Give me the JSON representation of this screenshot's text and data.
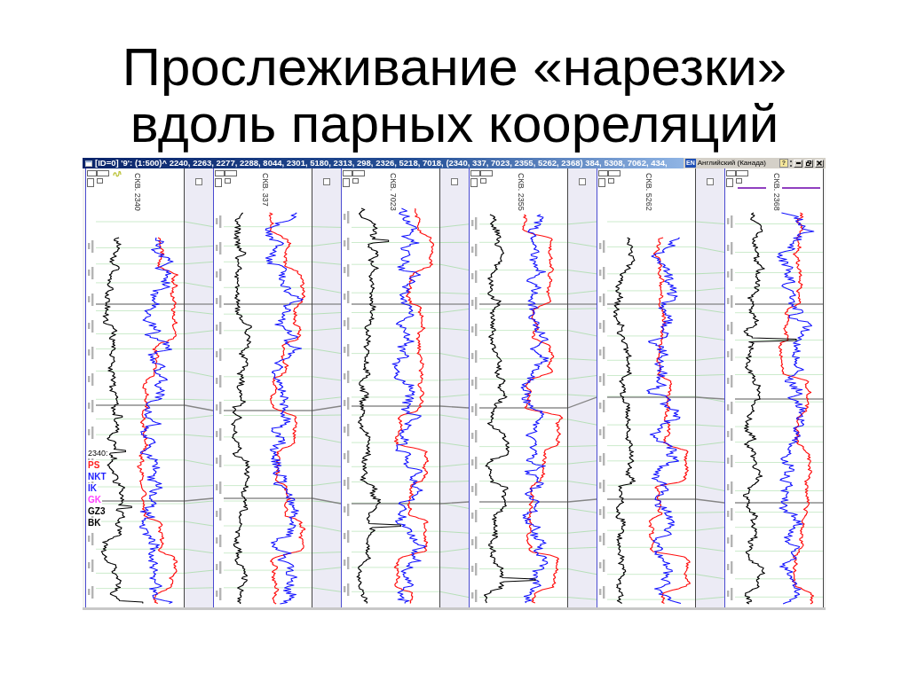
{
  "slide": {
    "title": "Прослеживание «нарезки»\nвдоль парных коореляций"
  },
  "window": {
    "title": "[ID=0] '9': (1:500)^ 2240, 2263, 2277, 2288, 8044, 2301, 5180, 2313, 298, 2326, 5218, 7018, (2340, 337, 7023, 2355, 5262, 2368) 384, 5308, 7062, 434,",
    "language_bar": {
      "badge": "EN",
      "language": "Английский (Канада)",
      "help": "?"
    },
    "columns": [
      {
        "kind": "well",
        "name": "СКВ. 2340",
        "legend": {
          "title": "2340:",
          "items": [
            {
              "label": "PS",
              "color": "#ff2020"
            },
            {
              "label": "NKT",
              "color": "#2020ff"
            },
            {
              "label": "IK",
              "color": "#2020ff"
            },
            {
              "label": "GK",
              "color": "#ff40ff"
            },
            {
              "label": "GZ3",
              "color": "#000000"
            },
            {
              "label": "BK",
              "color": "#000000"
            }
          ]
        }
      },
      {
        "kind": "separator",
        "checked": false
      },
      {
        "kind": "well",
        "name": "СКВ. 337"
      },
      {
        "kind": "separator",
        "checked": false
      },
      {
        "kind": "well",
        "name": "СКВ. 7023"
      },
      {
        "kind": "separator",
        "checked": false
      },
      {
        "kind": "well",
        "name": "СКВ. 2355"
      },
      {
        "kind": "separator",
        "checked": false
      },
      {
        "kind": "well",
        "name": "СКВ. 5262"
      },
      {
        "kind": "separator",
        "checked": false
      },
      {
        "kind": "well",
        "name": "СКВ. 2368"
      }
    ]
  }
}
